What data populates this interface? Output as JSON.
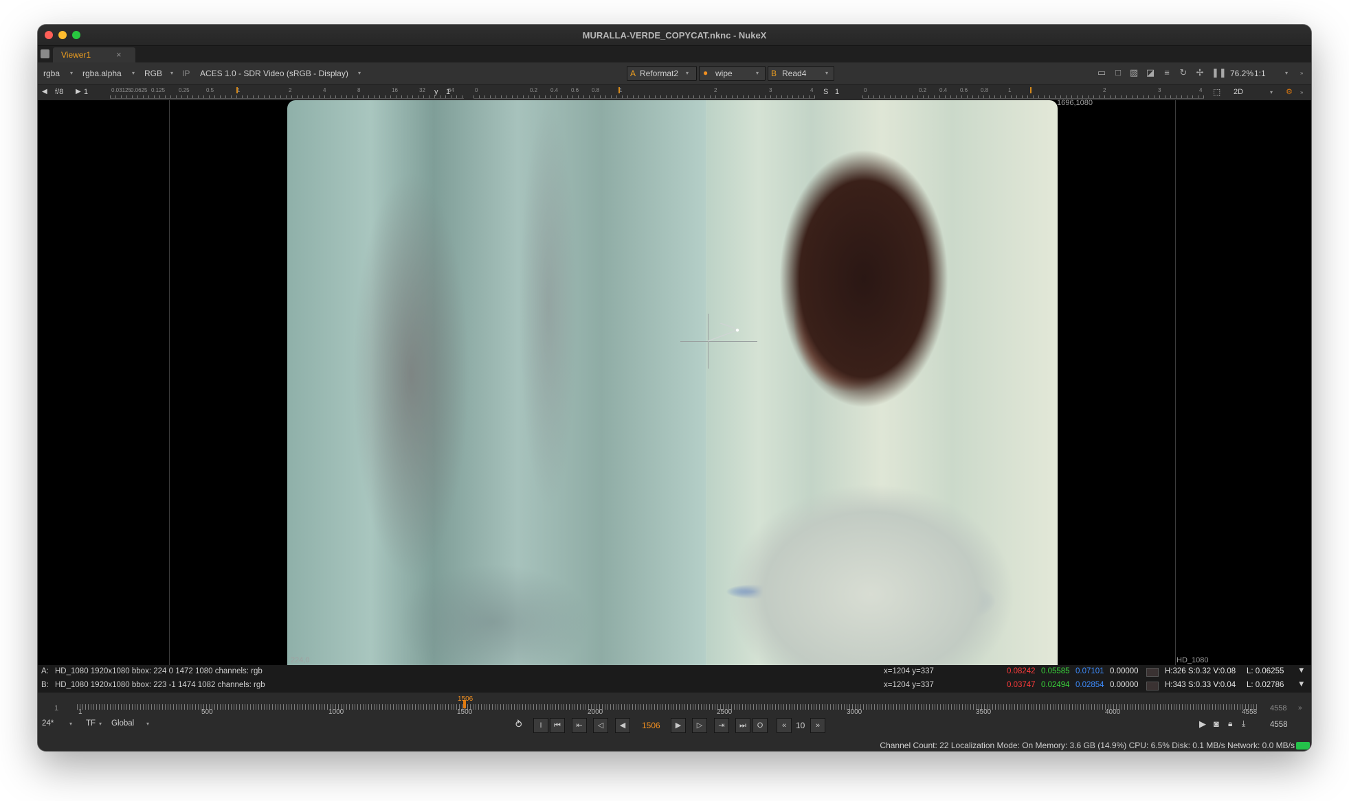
{
  "window": {
    "title": "MURALLA-VERDE_COPYCAT.nknc - NukeX"
  },
  "tabs": [
    {
      "label": "Viewer1",
      "close": "×"
    }
  ],
  "toolbar": {
    "channels": "rgba",
    "alpha": "rgba.alpha",
    "display_channels": "RGB",
    "ip": "IP",
    "colorspace": "ACES 1.0 - SDR Video (sRGB - Display)",
    "input_a_label": "A",
    "input_a": "Reformat2",
    "wipe_mode": "wipe",
    "input_b_label": "B",
    "input_b": "Read4",
    "zoom": "76.2%",
    "ratio": "1:1",
    "fstop": "f/8",
    "gain": "1",
    "gamma_label": "y",
    "gamma": "1",
    "saturation_label": "S",
    "saturation": "1",
    "view_mode": "2D"
  },
  "gain_ruler": [
    "0.03125",
    "0.0625",
    "0.125",
    "0.25",
    "0.5",
    "1",
    "2",
    "4",
    "8",
    "16",
    "32",
    "64"
  ],
  "gamma_ruler": [
    "0",
    "0.2",
    "0.4",
    "0.6",
    "0.8",
    "1",
    "2",
    "3",
    "4"
  ],
  "sat_ruler": [
    "0",
    "0.2",
    "0.4",
    "0.6",
    "0.8",
    "1",
    "2",
    "3",
    "4"
  ],
  "viewer": {
    "top_right_label": "1696,1080",
    "bottom_left_label": "224,0",
    "format_label": "HD_1080"
  },
  "info_a": {
    "prefix": "A:",
    "desc": "HD_1080 1920x1080  bbox: 224 0 1472 1080 channels: rgb",
    "coords": "x=1204 y=337",
    "r": "0.08242",
    "g": "0.05585",
    "b": "0.07101",
    "a": "0.00000",
    "hsv": "H:326 S:0.32 V:0.08",
    "l": "L: 0.06255"
  },
  "info_b": {
    "prefix": "B:",
    "desc": "HD_1080 1920x1080  bbox: 223 -1 1474 1082 channels: rgb",
    "coords": "x=1204 y=337",
    "r": "0.03747",
    "g": "0.02494",
    "b": "0.02854",
    "a": "0.00000",
    "hsv": "H:343 S:0.33 V:0.04",
    "l": "L: 0.02786"
  },
  "timeline": {
    "in_frame": "1",
    "current_frame": "1506",
    "out_frame": "4558",
    "ticks": [
      "1",
      "500",
      "1000",
      "1500",
      "2000",
      "2500",
      "3000",
      "3500",
      "4000",
      "4558"
    ],
    "fps": "24*",
    "tf": "TF",
    "scope": "Global",
    "in_button": "I",
    "out_button": "O",
    "skip_frames": "10",
    "end_frame": "4558"
  },
  "status": "Channel Count: 22  Localization Mode: On  Memory: 3.6 GB (14.9%)  CPU: 6.5%  Disk: 0.1 MB/s  Network: 0.0 MB/s"
}
